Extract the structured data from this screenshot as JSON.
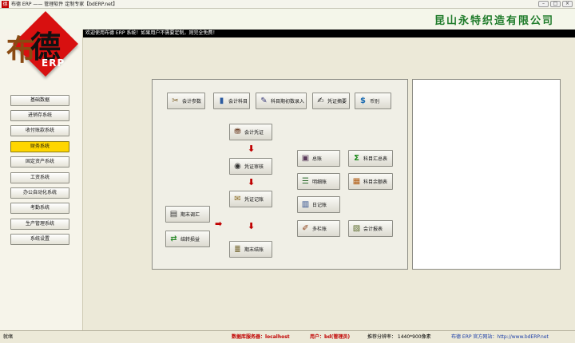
{
  "window": {
    "title": "布德 ERP —— 管理软件 定制专家【bdERP.net】",
    "app_icon": "德",
    "buttons": [
      "–",
      "□",
      "×"
    ]
  },
  "header": {
    "company": "昆山永特织造有限公司"
  },
  "logo": {
    "char_main": "德",
    "char_side": "布",
    "erp": "ERP"
  },
  "welcome": "欢迎使用布德 ERP 系统！如果用户不需要定制，则完全免费！",
  "sidebar": {
    "items": [
      {
        "label": "基础数据",
        "active": false
      },
      {
        "label": "进销存系统",
        "active": false
      },
      {
        "label": "收付账款系统",
        "active": false
      },
      {
        "label": "财务系统",
        "active": true
      },
      {
        "label": "固定资产系统",
        "active": false
      },
      {
        "label": "工资系统",
        "active": false
      },
      {
        "label": "办公自动化系统",
        "active": false
      },
      {
        "label": "考勤系统",
        "active": false
      },
      {
        "label": "生产管理系统",
        "active": false
      },
      {
        "label": "系统设置",
        "active": false
      }
    ]
  },
  "flow": {
    "accounting_params": "会计参数",
    "account_subjects": "会计科目",
    "opening_balance": "科目期初数录入",
    "voucher_summary": "凭证摘要",
    "currency": "币别",
    "accounting_voucher": "会计凭证",
    "voucher_audit": "凭证审核",
    "voucher_posting": "凭证记账",
    "period_adjust": "期末调汇",
    "carry_forward": "结转损益",
    "period_close": "期末结账",
    "general_ledger": "总账",
    "subject_summary": "科目汇总表",
    "detail_ledger": "明细账",
    "subject_balance": "科目余额表",
    "journal": "日记账",
    "multi_column": "多栏账",
    "accounting_report": "会计报表"
  },
  "icons": {
    "accounting_params": "tools-icon",
    "account_subjects": "books-icon",
    "opening_balance": "pen-icon",
    "voucher_summary": "document-edit-icon",
    "currency": "dollar-icon",
    "accounting_voucher": "stamp-icon",
    "voucher_audit": "seal-icon",
    "voucher_posting": "posting-icon",
    "period_adjust": "ledger-icon",
    "carry_forward": "transfer-icon",
    "period_close": "stack-icon",
    "general_ledger": "ledger-book-icon",
    "subject_summary": "sigma-icon",
    "detail_ledger": "list-icon",
    "subject_balance": "balance-icon",
    "journal": "calendar-icon",
    "multi_column": "columns-icon",
    "accounting_report": "report-icon"
  },
  "status": {
    "state": "就绪",
    "db_server": "数据库服务器：localhost",
    "user": "用户：bd(管理员)",
    "resolution": "推荐分辨率： 1440*900像素",
    "website": "布德 ERP 官方网站：http://www.bdERP.net"
  },
  "colors": {
    "company": "#1E7B2A",
    "logo_red": "#D81010",
    "active_nav": "#FFD600",
    "arrow_red": "#C00000"
  }
}
